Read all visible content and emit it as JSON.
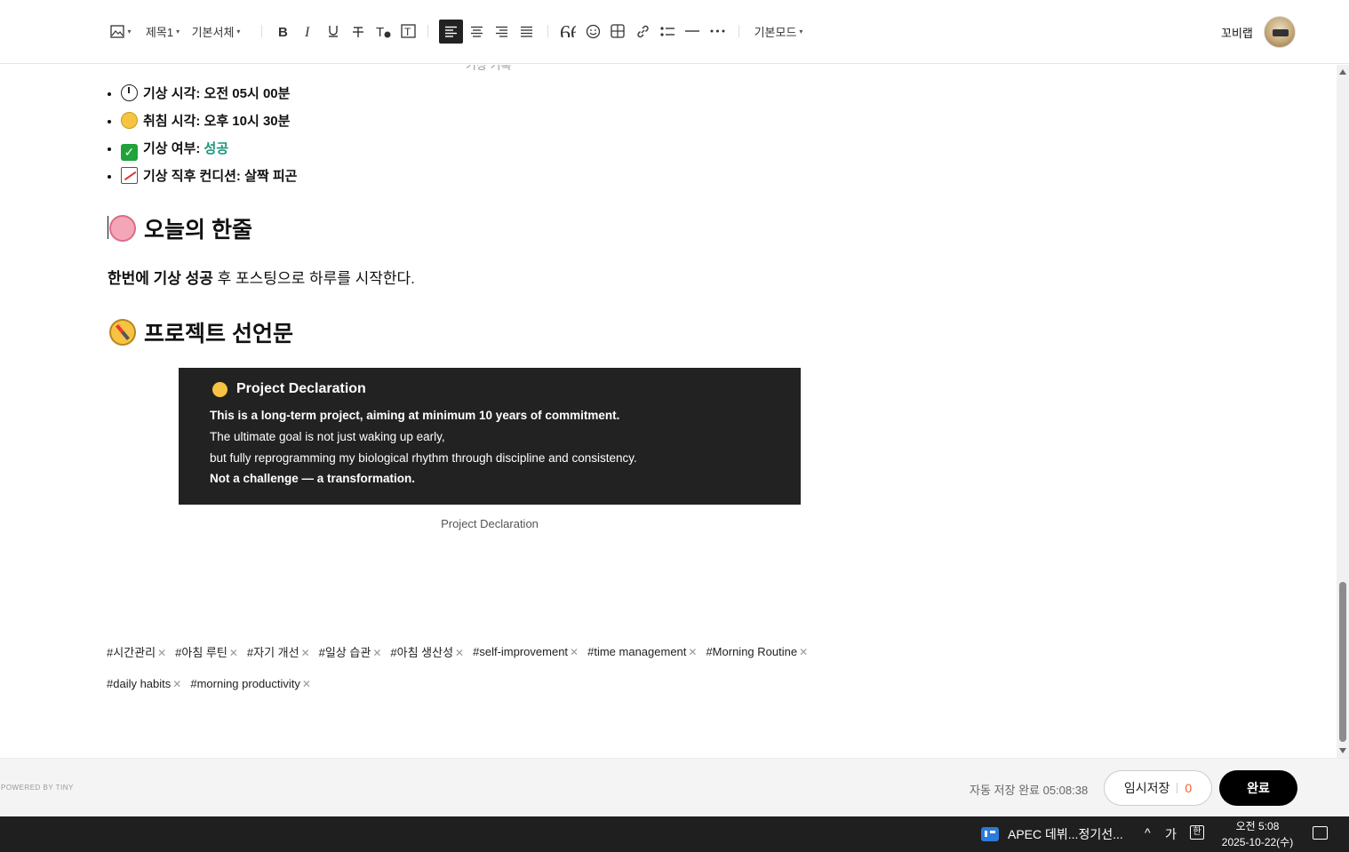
{
  "toolbar": {
    "heading_label": "제목1",
    "font_label": "기본서체",
    "mode_label": "기본모드",
    "user_name": "꼬비랩"
  },
  "content": {
    "cut_text": "기상 기록",
    "facts": [
      {
        "label": "기상 시각: 오전 05시 00분",
        "icon": "clock-icon"
      },
      {
        "label": "취침 시각: 오후 10시 30분",
        "icon": "sleepy-face-icon"
      },
      {
        "label": "기상 여부: ",
        "value": "성공",
        "icon": "check-mark-icon"
      },
      {
        "label": "기상 직후 컨디션: 살짝 피곤",
        "icon": "chart-icon"
      }
    ],
    "heading_today": "오늘의 한줄",
    "today_bold": "한번에 기상 성공",
    "today_rest": " 후 포스팅으로 하루를 시작한다.",
    "heading_project": "프로젝트 선언문",
    "declaration": {
      "title": "Project Declaration",
      "line1": "This is a long-term project, aiming at minimum 10 years of commitment.",
      "line2": "The ultimate goal is not just waking up early,",
      "line3": "but fully reprogramming my biological rhythm through discipline and consistency.",
      "line4": "Not a challenge — a transformation."
    },
    "caption": "Project Declaration",
    "tags_row1": [
      "#시간관리",
      "#아침 루틴",
      "#자기 개선",
      "#일상 습관",
      "#아침 생산성",
      "#self-improvement",
      "#time management",
      "#Morning Routine"
    ],
    "tags_row2": [
      "#daily habits",
      "#morning productivity"
    ]
  },
  "footer": {
    "powered": "POWERED BY TINY",
    "autosave_label": "자동 저장 완료",
    "autosave_time": "05:08:38",
    "draft_label": "임시저장",
    "draft_count": "0",
    "done_label": "완료"
  },
  "taskbar": {
    "app_label": "APEC 데뷔...정기선...",
    "ime_lang": "가",
    "time": "오전 5:08",
    "date": "2025-10-22(수)"
  },
  "colors": {
    "accent_green": "#16967a",
    "draft_count": "#f25c2e",
    "declaration_bg": "#222222"
  }
}
